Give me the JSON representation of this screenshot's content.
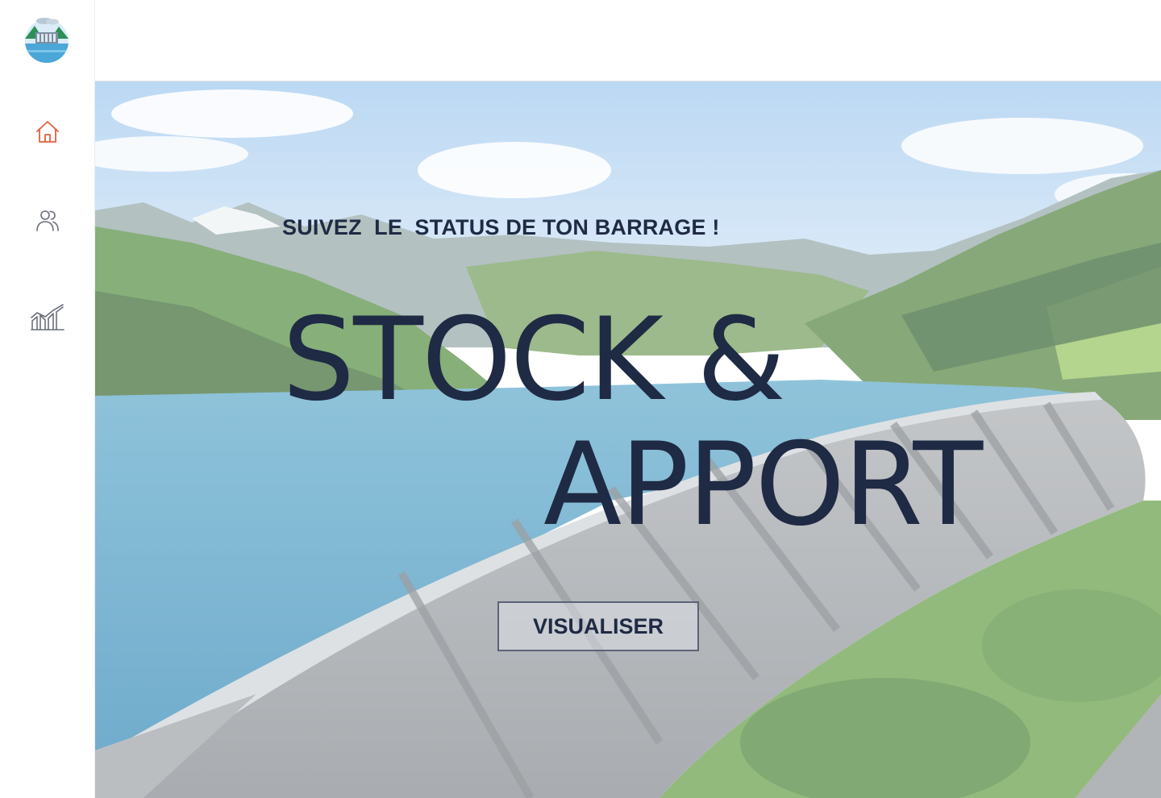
{
  "sidebar": {
    "items": [
      {
        "id": "home",
        "icon": "home-icon",
        "active": true
      },
      {
        "id": "users",
        "icon": "users-icon",
        "active": false
      },
      {
        "id": "stats",
        "icon": "chart-icon",
        "active": false
      }
    ]
  },
  "hero": {
    "tagline": "SUIVEZ  LE  STATUS DE TON BARRAGE !",
    "title_line1": "STOCK &",
    "title_line2": "APPORT",
    "cta_label": "VISUALISER"
  },
  "colors": {
    "accent": "#e2603f",
    "text_dark": "#1f2a44",
    "icon_gray": "#6b6f7a"
  }
}
